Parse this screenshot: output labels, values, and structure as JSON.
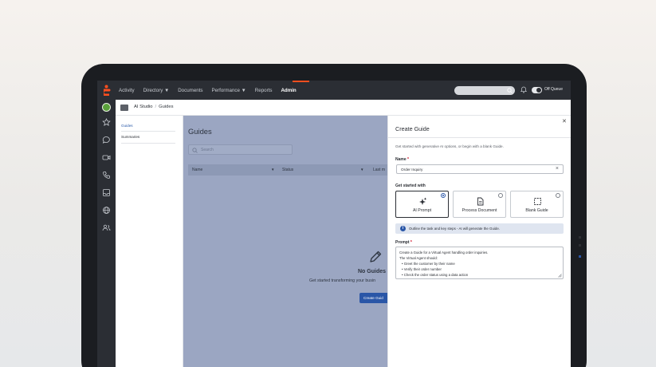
{
  "topnav": {
    "items": [
      "Activity",
      "Directory ▼",
      "Documents",
      "Performance ▼",
      "Reports",
      "Admin"
    ],
    "active": "Admin",
    "status": "Off Queue"
  },
  "breadcrumb": {
    "root": "AI Studio",
    "separator": "/",
    "current": "Guides"
  },
  "subnav": {
    "items": [
      "Guides",
      "Summaries"
    ]
  },
  "main": {
    "title": "Guides",
    "search_placeholder": "Search",
    "columns": [
      "Name",
      "Status",
      "Last m"
    ],
    "empty_title": "No Guides",
    "empty_desc": "Get started transforming your busin",
    "create_label": "Create Guid"
  },
  "panel": {
    "title": "Create Guide",
    "intro": "Get started with generative AI options, or begin with a blank Guide.",
    "name_label": "Name",
    "name_value": "Order Inquiry",
    "getstarted_label": "Get started with",
    "options": [
      {
        "label": "AI Prompt",
        "icon": "sparkle-icon",
        "selected": true
      },
      {
        "label": "Process Document",
        "icon": "document-icon",
        "selected": false
      },
      {
        "label": "Blank Guide",
        "icon": "blank-frame-icon",
        "selected": false
      }
    ],
    "info": "Outline the task and key steps - AI will generate the Guide.",
    "prompt_label": "Prompt",
    "prompt_lines": [
      "Create a Guide for a Virtual Agent handling order inquiries.",
      "The Virtual Agent should:",
      "•  Greet the customer by their name",
      "•  Verify their order number",
      "•  Check the order status using a data action"
    ],
    "required_mark": "*"
  },
  "colors": {
    "accent": "#ff4f1f",
    "primary": "#2a56a7",
    "overlay": "#9ba6c2",
    "chrome": "#2b2e34"
  }
}
